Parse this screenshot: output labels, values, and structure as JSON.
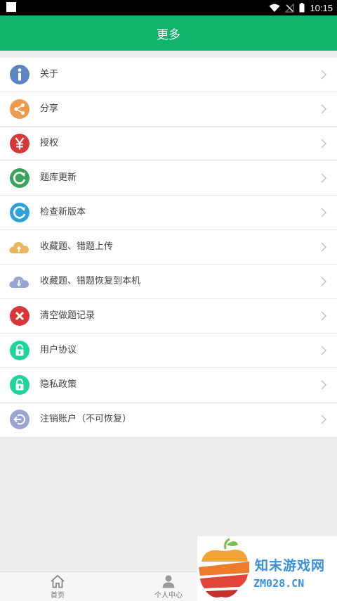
{
  "status_bar": {
    "time": "10:15"
  },
  "header": {
    "title": "更多"
  },
  "menu": [
    {
      "label": "关于",
      "icon": "info-icon",
      "color": "#5e85c3"
    },
    {
      "label": "分享",
      "icon": "share-icon",
      "color": "#ee9a4d"
    },
    {
      "label": "授权",
      "icon": "yen-icon",
      "color": "#d83737"
    },
    {
      "label": "题库更新",
      "icon": "refresh-icon",
      "color": "#3aa35d"
    },
    {
      "label": "检查新版本",
      "icon": "update-icon",
      "color": "#2ea1dc"
    },
    {
      "label": "收藏题、错题上传",
      "icon": "cloud-upload-icon",
      "color": "#e9b65e"
    },
    {
      "label": "收藏题、错题恢复到本机",
      "icon": "cloud-download-icon",
      "color": "#98a5d4"
    },
    {
      "label": "清空做题记录",
      "icon": "clear-icon",
      "color": "#d83737"
    },
    {
      "label": "用户协议",
      "icon": "lock-icon",
      "color": "#1dd49a"
    },
    {
      "label": "隐私政策",
      "icon": "lock-icon",
      "color": "#1dd49a"
    },
    {
      "label": "注销账户（不可恢复）",
      "icon": "logout-icon",
      "color": "#98a5d4"
    }
  ],
  "bottom_nav": {
    "home_label": "首页",
    "profile_label": "个人中心"
  },
  "watermark": {
    "cn": "知末游戏网",
    "en": "ZM028.CN"
  },
  "colors": {
    "primary": "#12b46a",
    "background": "#ececec"
  }
}
